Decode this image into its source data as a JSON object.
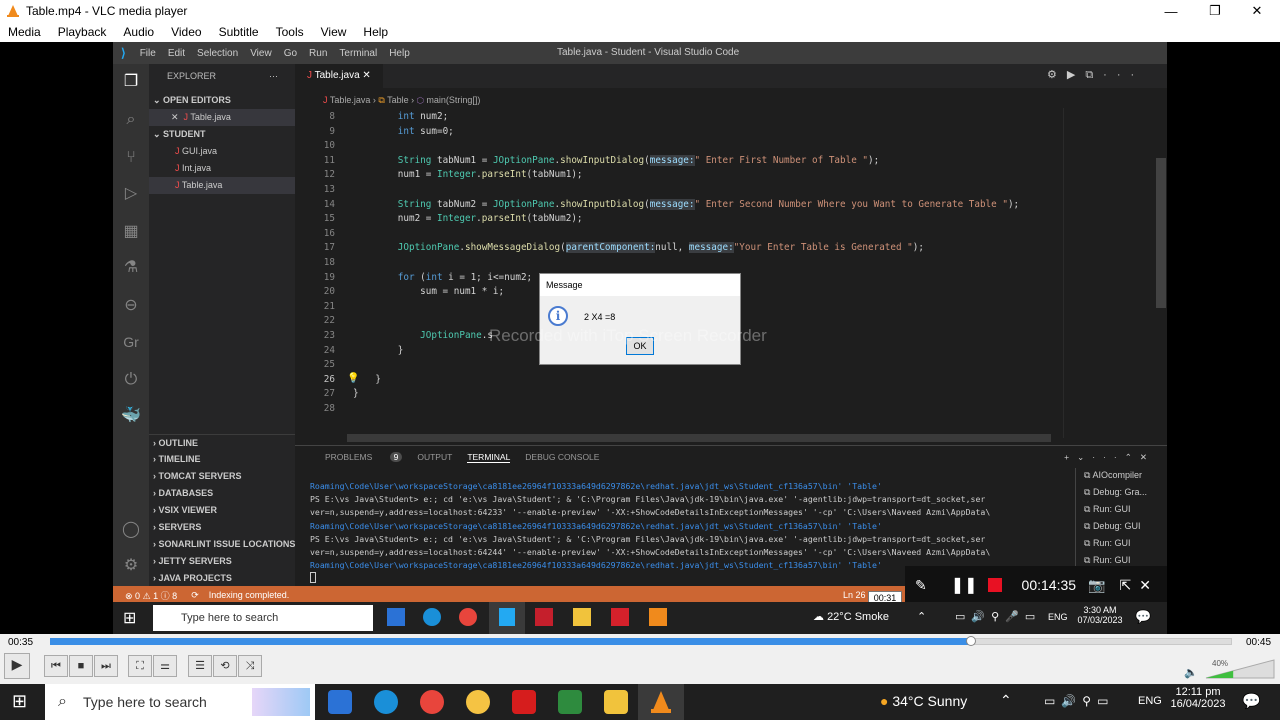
{
  "vlc": {
    "title": "Table.mp4 - VLC media player",
    "menu": [
      "Media",
      "Playback",
      "Audio",
      "Video",
      "Subtitle",
      "Tools",
      "View",
      "Help"
    ],
    "time_elapsed": "00:35",
    "time_total": "00:45",
    "seek_hover": "00:31",
    "progress_fraction": 0.779,
    "volume": "40%",
    "accent": "#3a8ee6"
  },
  "vscode": {
    "menu": [
      "File",
      "Edit",
      "Selection",
      "View",
      "Go",
      "Run",
      "Terminal",
      "Help"
    ],
    "window_title": "Table.java - Student - Visual Studio Code",
    "explorer_title": "EXPLORER",
    "open_editors_label": "OPEN EDITORS",
    "open_editor_file": "Table.java",
    "project_label": "STUDENT",
    "files": [
      "GUI.java",
      "Int.java",
      "Table.java"
    ],
    "sections": [
      "OUTLINE",
      "TIMELINE",
      "TOMCAT SERVERS",
      "DATABASES",
      "VSIX VIEWER",
      "SERVERS",
      "SONARLINT ISSUE LOCATIONS",
      "JETTY SERVERS",
      "JAVA PROJECTS"
    ],
    "tab_label": "Table.java",
    "breadcrumb": [
      "Table.java",
      "Table",
      "main(String[])"
    ],
    "status_errors": "0",
    "status_warnings": "1",
    "status_info": "8",
    "status_text": "Indexing completed.",
    "status_position": "Ln 26",
    "panel_tabs": [
      "PROBLEMS",
      "OUTPUT",
      "TERMINAL",
      "DEBUG CONSOLE"
    ],
    "problems_count": "9",
    "terminal_sessions": [
      "AIOcompiler",
      "Debug: Gra...",
      "Run: GUI",
      "Debug: GUI",
      "Run: GUI",
      "Run: GUI"
    ],
    "status_color": "#cc6633"
  },
  "code_lines": [
    {
      "n": "8",
      "t": "        int num2;"
    },
    {
      "n": "9",
      "t": "        int sum=0;"
    },
    {
      "n": "10",
      "t": ""
    },
    {
      "n": "11",
      "t": "        String tabNum1 = JOptionPane.showInputDialog(message:\" Enter First Number of Table \");"
    },
    {
      "n": "12",
      "t": "        num1 = Integer.parseInt(tabNum1);"
    },
    {
      "n": "13",
      "t": ""
    },
    {
      "n": "14",
      "t": "        String tabNum2 = JOptionPane.showInputDialog(message:\" Enter Second Number Where you Want to Generate Table \");"
    },
    {
      "n": "15",
      "t": "        num2 = Integer.parseInt(tabNum2);"
    },
    {
      "n": "16",
      "t": ""
    },
    {
      "n": "17",
      "t": "        JOptionPane.showMessageDialog(parentComponent:null, message:\"Your Enter Table is Generated \");"
    },
    {
      "n": "18",
      "t": ""
    },
    {
      "n": "19",
      "t": "        for (int i = 1; i<=num2;"
    },
    {
      "n": "20",
      "t": "            sum = num1 * i;"
    },
    {
      "n": "21",
      "t": ""
    },
    {
      "n": "22",
      "t": ""
    },
    {
      "n": "23",
      "t": "            JOptionPane.s                           \"+ i +\" =\"+ sum);"
    },
    {
      "n": "24",
      "t": "        }"
    },
    {
      "n": "25",
      "t": ""
    },
    {
      "n": "26",
      "t": "    }"
    },
    {
      "n": "27",
      "t": "}"
    },
    {
      "n": "28",
      "t": ""
    }
  ],
  "terminal_lines": [
    {
      "c": "blue",
      "t": "Roaming\\Code\\User\\workspaceStorage\\ca8181ee26964f10333a649d6297862e\\redhat.java\\jdt_ws\\Student_cf136a57\\bin' 'Table'"
    },
    {
      "c": "",
      "t": "PS E:\\vs Java\\Student>  e:; cd 'e:\\vs Java\\Student'; & 'C:\\Program Files\\Java\\jdk-19\\bin\\java.exe' '-agentlib:jdwp=transport=dt_socket,ser"
    },
    {
      "c": "",
      "t": "ver=n,suspend=y,address=localhost:64233' '--enable-preview' '-XX:+ShowCodeDetailsInExceptionMessages' '-cp' 'C:\\Users\\Naveed Azmi\\AppData\\"
    },
    {
      "c": "blue",
      "t": "Roaming\\Code\\User\\workspaceStorage\\ca8181ee26964f10333a649d6297862e\\redhat.java\\jdt_ws\\Student_cf136a57\\bin' 'Table'"
    },
    {
      "c": "",
      "t": "PS E:\\vs Java\\Student>  e:; cd 'e:\\vs Java\\Student'; & 'C:\\Program Files\\Java\\jdk-19\\bin\\java.exe' '-agentlib:jdwp=transport=dt_socket,ser"
    },
    {
      "c": "",
      "t": "ver=n,suspend=y,address=localhost:64244' '--enable-preview' '-XX:+ShowCodeDetailsInExceptionMessages' '-cp' 'C:\\Users\\Naveed Azmi\\AppData\\"
    },
    {
      "c": "blue",
      "t": "Roaming\\Code\\User\\workspaceStorage\\ca8181ee26964f10333a649d6297862e\\redhat.java\\jdt_ws\\Student_cf136a57\\bin' 'Table'"
    }
  ],
  "dialog": {
    "title": "Message",
    "message": "2 X4 =8",
    "ok": "OK"
  },
  "watermark": "Recorded with iTop Screen Recorder",
  "recorder": {
    "time": "00:14:35"
  },
  "inner_taskbar": {
    "search": "Type here to search",
    "weather": "22°C  Smoke",
    "lang": "ENG",
    "time": "3:30 AM",
    "date": "07/03/2023"
  },
  "outer_taskbar": {
    "search": "Type here to search",
    "weather": "34°C  Sunny",
    "lang": "ENG",
    "time": "12:11 pm",
    "date": "16/04/2023"
  }
}
